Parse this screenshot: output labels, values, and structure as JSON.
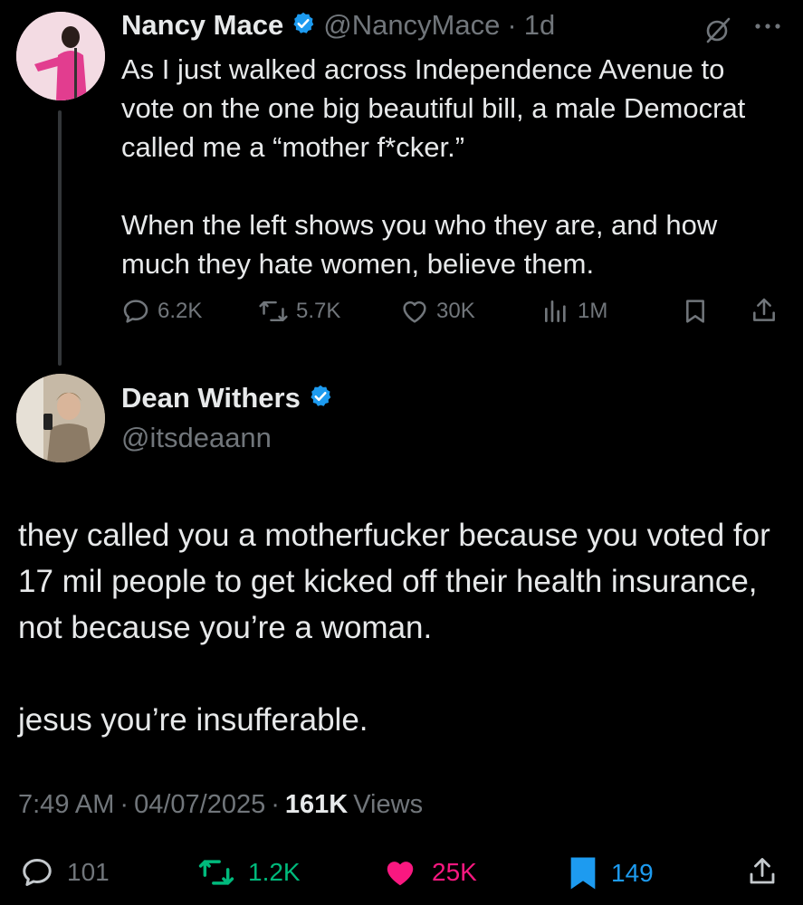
{
  "parent_tweet": {
    "author_name": "Nancy Mace",
    "handle": "@NancyMace",
    "separator": "·",
    "age": "1d",
    "paragraphs": [
      "As I just walked across Independence Avenue to vote on the one big beautiful bill, a male Democrat called me a “mother f*cker.”",
      "When the left shows you who they are, and how much they hate women, believe them."
    ],
    "stats": {
      "replies": "6.2K",
      "reposts": "5.7K",
      "likes": "30K",
      "views": "1M"
    }
  },
  "reply_tweet": {
    "author_name": "Dean Withers",
    "handle": "@itsdeaann",
    "paragraphs": [
      "they called you a motherfucker because you voted for 17 mil people to get kicked off their health insurance, not because you’re a woman.",
      "jesus you’re insufferable."
    ],
    "time": "7:49 AM",
    "separator": "·",
    "date": "04/07/2025",
    "views_count": "161K",
    "views_label": "Views",
    "stats": {
      "replies": "101",
      "reposts": "1.2K",
      "likes": "25K",
      "bookmarks": "149"
    }
  },
  "colors": {
    "background": "#000000",
    "text": "#e7e9ea",
    "muted": "#71767b",
    "verified": "#1d9bf0",
    "repost_active": "#00ba7c",
    "like_active": "#f91880",
    "bookmark_active": "#1d9bf0"
  },
  "icons": [
    "verified-badge-icon",
    "grok-icon",
    "more-icon",
    "reply-icon",
    "repost-icon",
    "like-icon",
    "views-icon",
    "bookmark-icon",
    "share-icon"
  ]
}
